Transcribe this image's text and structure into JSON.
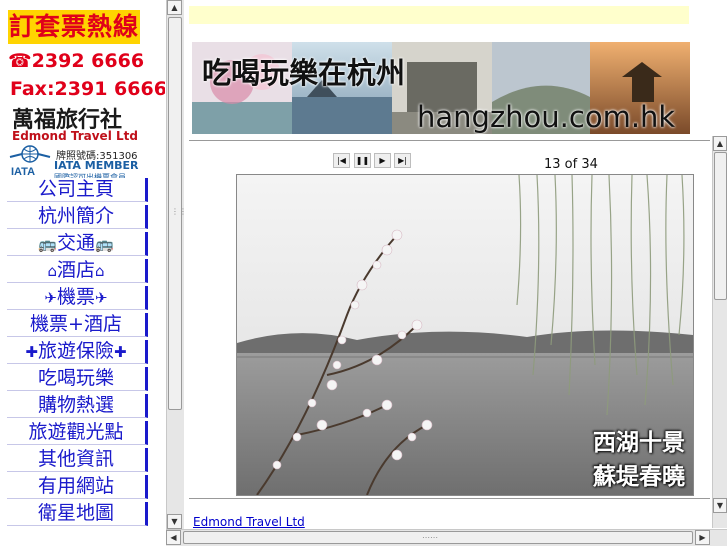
{
  "left": {
    "hotline_title": "訂套票熱線",
    "phone": "☎2392 6666",
    "fax": "Fax:2391 6666",
    "company_zh": "萬福旅行社",
    "company_en": "Edmond Travel Ltd",
    "license": "牌照號碼:351306",
    "iata_member": "IATA MEMBER",
    "iata_sub": "國際認可出機票會員",
    "nav": [
      {
        "label": "公司主頁"
      },
      {
        "label": "杭州簡介"
      },
      {
        "label": "交通",
        "deco": "🚌"
      },
      {
        "label": "酒店",
        "deco": "⌂"
      },
      {
        "label": "機票",
        "deco": "✈"
      },
      {
        "label": "機票+酒店"
      },
      {
        "label": "旅遊保險",
        "deco": "✚"
      },
      {
        "label": "吃喝玩樂"
      },
      {
        "label": "購物熱選"
      },
      {
        "label": "旅遊觀光點"
      },
      {
        "label": "其他資訊"
      },
      {
        "label": "有用網站"
      },
      {
        "label": "衛星地圖"
      }
    ]
  },
  "top_menu": [
    "",
    "",
    "",
    "",
    ""
  ],
  "banner": {
    "title": "吃喝玩樂在杭州",
    "url": "hangzhou.com.hk"
  },
  "slideshow": {
    "counter": "13 of 34",
    "caption_line1": "西湖十景",
    "caption_line2": "蘇堤春曉"
  },
  "footer": {
    "prefix": "",
    "link": " Edmond Travel Ltd"
  },
  "colors": {
    "nav_blue": "#1a1acb",
    "hotline_red": "#e0001a",
    "menu_bg": "#ffffcc"
  }
}
